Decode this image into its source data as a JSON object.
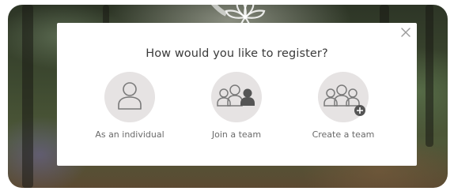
{
  "dialog": {
    "title": "How would you like to register?",
    "close_icon": "close-icon",
    "options": [
      {
        "label": "As an individual",
        "icon": "person-icon"
      },
      {
        "label": "Join a team",
        "icon": "team-join-icon"
      },
      {
        "label": "Create a team",
        "icon": "team-create-icon"
      }
    ]
  },
  "colors": {
    "icon_circle": "#e6e3e3",
    "icon_stroke": "#7a7a7a",
    "icon_fill_dark": "#555555",
    "title_text": "#3a3a3a",
    "label_text": "#6a6a6a"
  }
}
